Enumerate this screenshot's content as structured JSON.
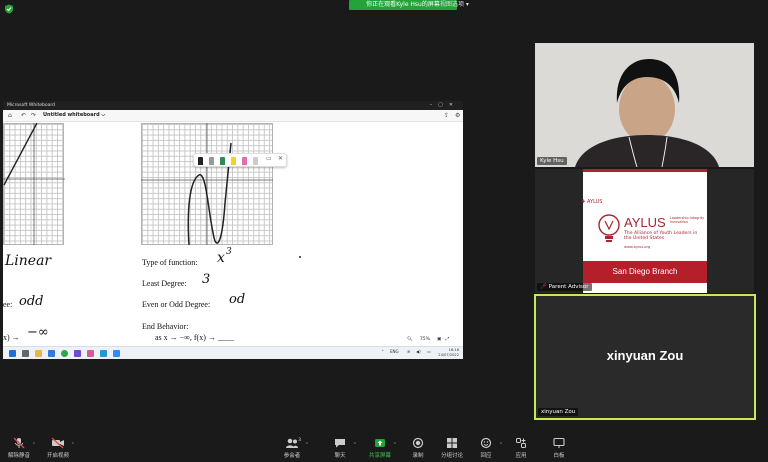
{
  "banner": {
    "sharing": "你正在观看Kyle Hsu的屏幕",
    "view_options": "视图选项 ▾"
  },
  "whiteboard": {
    "window_title": "Microsoft Whiteboard",
    "doc_title": "Untitled whiteboard ⌵",
    "zoom": "75%",
    "left_col": {
      "word": "Linear",
      "parity_suffix": "ee:",
      "parity": "odd",
      "end_prefix": "x) →",
      "end_value": "−∞"
    },
    "right_col": {
      "type_label": "Type of function:",
      "type_value": "x",
      "type_exp": "3",
      "degree_label": "Least Degree:",
      "degree_value": "3",
      "parity_label": "Even or Odd Degree:",
      "parity_value": "od",
      "end_label": "End Behavior:",
      "end_line": "as x → −∞, f(x) → ____"
    },
    "taskbar": {
      "lang": "ENG",
      "time": "16:18",
      "date": "24/07/2022"
    }
  },
  "participants": [
    {
      "name": "Kyle Hsu"
    },
    {
      "name": "Parent Advisor"
    },
    {
      "name": "xinyuan Zou"
    }
  ],
  "aylus": {
    "bullet": "AYLUS",
    "title": "AYLUS",
    "tagline": "Leadership Integrity Innovation",
    "subtitle": "The Alliance of Youth Leaders in the United States",
    "website": "www.aylus.org",
    "branch": "San Diego Branch"
  },
  "toolbar": {
    "mute": "解除静音",
    "video": "开启视频",
    "participants": "参会者",
    "participants_count": "3",
    "chat": "聊天",
    "share": "共享屏幕",
    "record": "录制",
    "breakout": "分组讨论",
    "reactions": "回应",
    "apps": "应用",
    "whiteboard": "白板"
  },
  "colors": {
    "zoom_green": "#23a33a",
    "active_border": "#c7e85a",
    "aylus_red": "#a72630"
  }
}
